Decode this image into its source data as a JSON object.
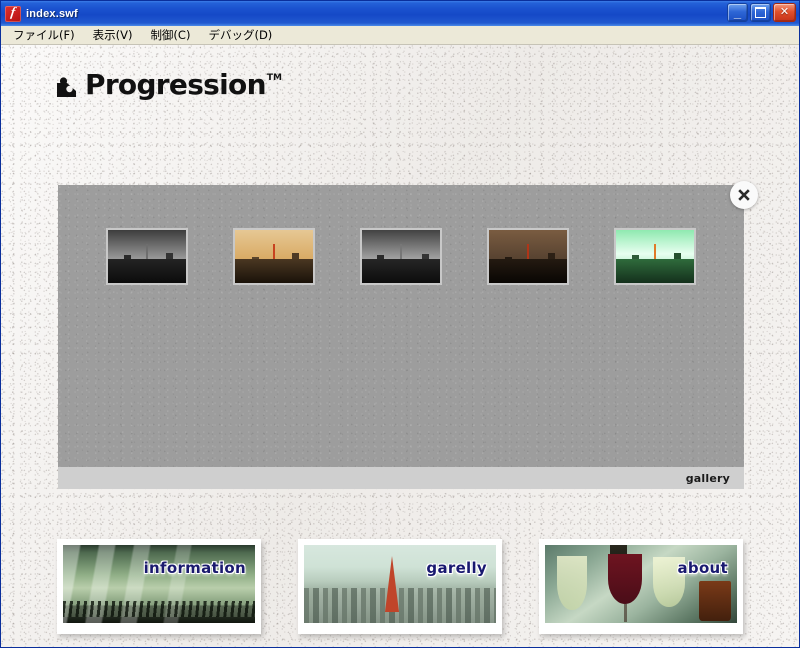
{
  "window": {
    "title": "index.swf",
    "app_icon": "flash-icon",
    "buttons": {
      "minimize": "_",
      "maximize": "maximize-icon",
      "close": "✕"
    }
  },
  "menubar": {
    "items": [
      {
        "label": "ファイル(F)",
        "name": "menu-file"
      },
      {
        "label": "表示(V)",
        "name": "menu-view"
      },
      {
        "label": "制御(C)",
        "name": "menu-control"
      },
      {
        "label": "デバッグ(D)",
        "name": "menu-debug"
      }
    ]
  },
  "logo": {
    "wordmark": "Progression",
    "trademark": "TM",
    "mark_icon": "progression-mark-icon"
  },
  "gallery_panel": {
    "footer_label": "gallery",
    "close_button": {
      "icon": "close-x-icon",
      "label": "✕"
    },
    "thumbnails": [
      {
        "name": "thumbnail-1",
        "tone": "grayscale",
        "sky": "#3d3d3d",
        "sky2": "#c9c9c9",
        "city": "#101010",
        "tower": "#6e6e6e"
      },
      {
        "name": "thumbnail-2",
        "tone": "sepia-amber",
        "sky": "#d8a860",
        "sky2": "#e6c894",
        "city": "#2a1f12",
        "tower": "#c8421f"
      },
      {
        "name": "thumbnail-3",
        "tone": "grayscale",
        "sky": "#424242",
        "sky2": "#cfcfcf",
        "city": "#111111",
        "tower": "#777777"
      },
      {
        "name": "thumbnail-4",
        "tone": "dark-brown",
        "sky": "#54402f",
        "sky2": "#7a5c41",
        "city": "#130d08",
        "tower": "#b03518"
      },
      {
        "name": "thumbnail-5",
        "tone": "green-tinted",
        "sky": "#7fe6a8",
        "sky2": "#e8fff0",
        "city": "#1d3a22",
        "tower": "#e07a28"
      }
    ]
  },
  "cards": [
    {
      "name": "card-information",
      "label": "information",
      "label_color": "#1a1a6e",
      "image": "subway-platform-photo"
    },
    {
      "name": "card-garelly",
      "label": "garelly",
      "label_color": "#191970",
      "image": "tokyo-tower-cityscape-photo"
    },
    {
      "name": "card-about",
      "label": "about",
      "label_color": "#191970",
      "image": "wine-glasses-photo"
    }
  ],
  "colors": {
    "titlebar_blue": "#1b52cf",
    "panel_gray": "#9d9d9d",
    "panel_footer_gray": "#cfcfcf",
    "stage_background": "#f4f2f0"
  }
}
